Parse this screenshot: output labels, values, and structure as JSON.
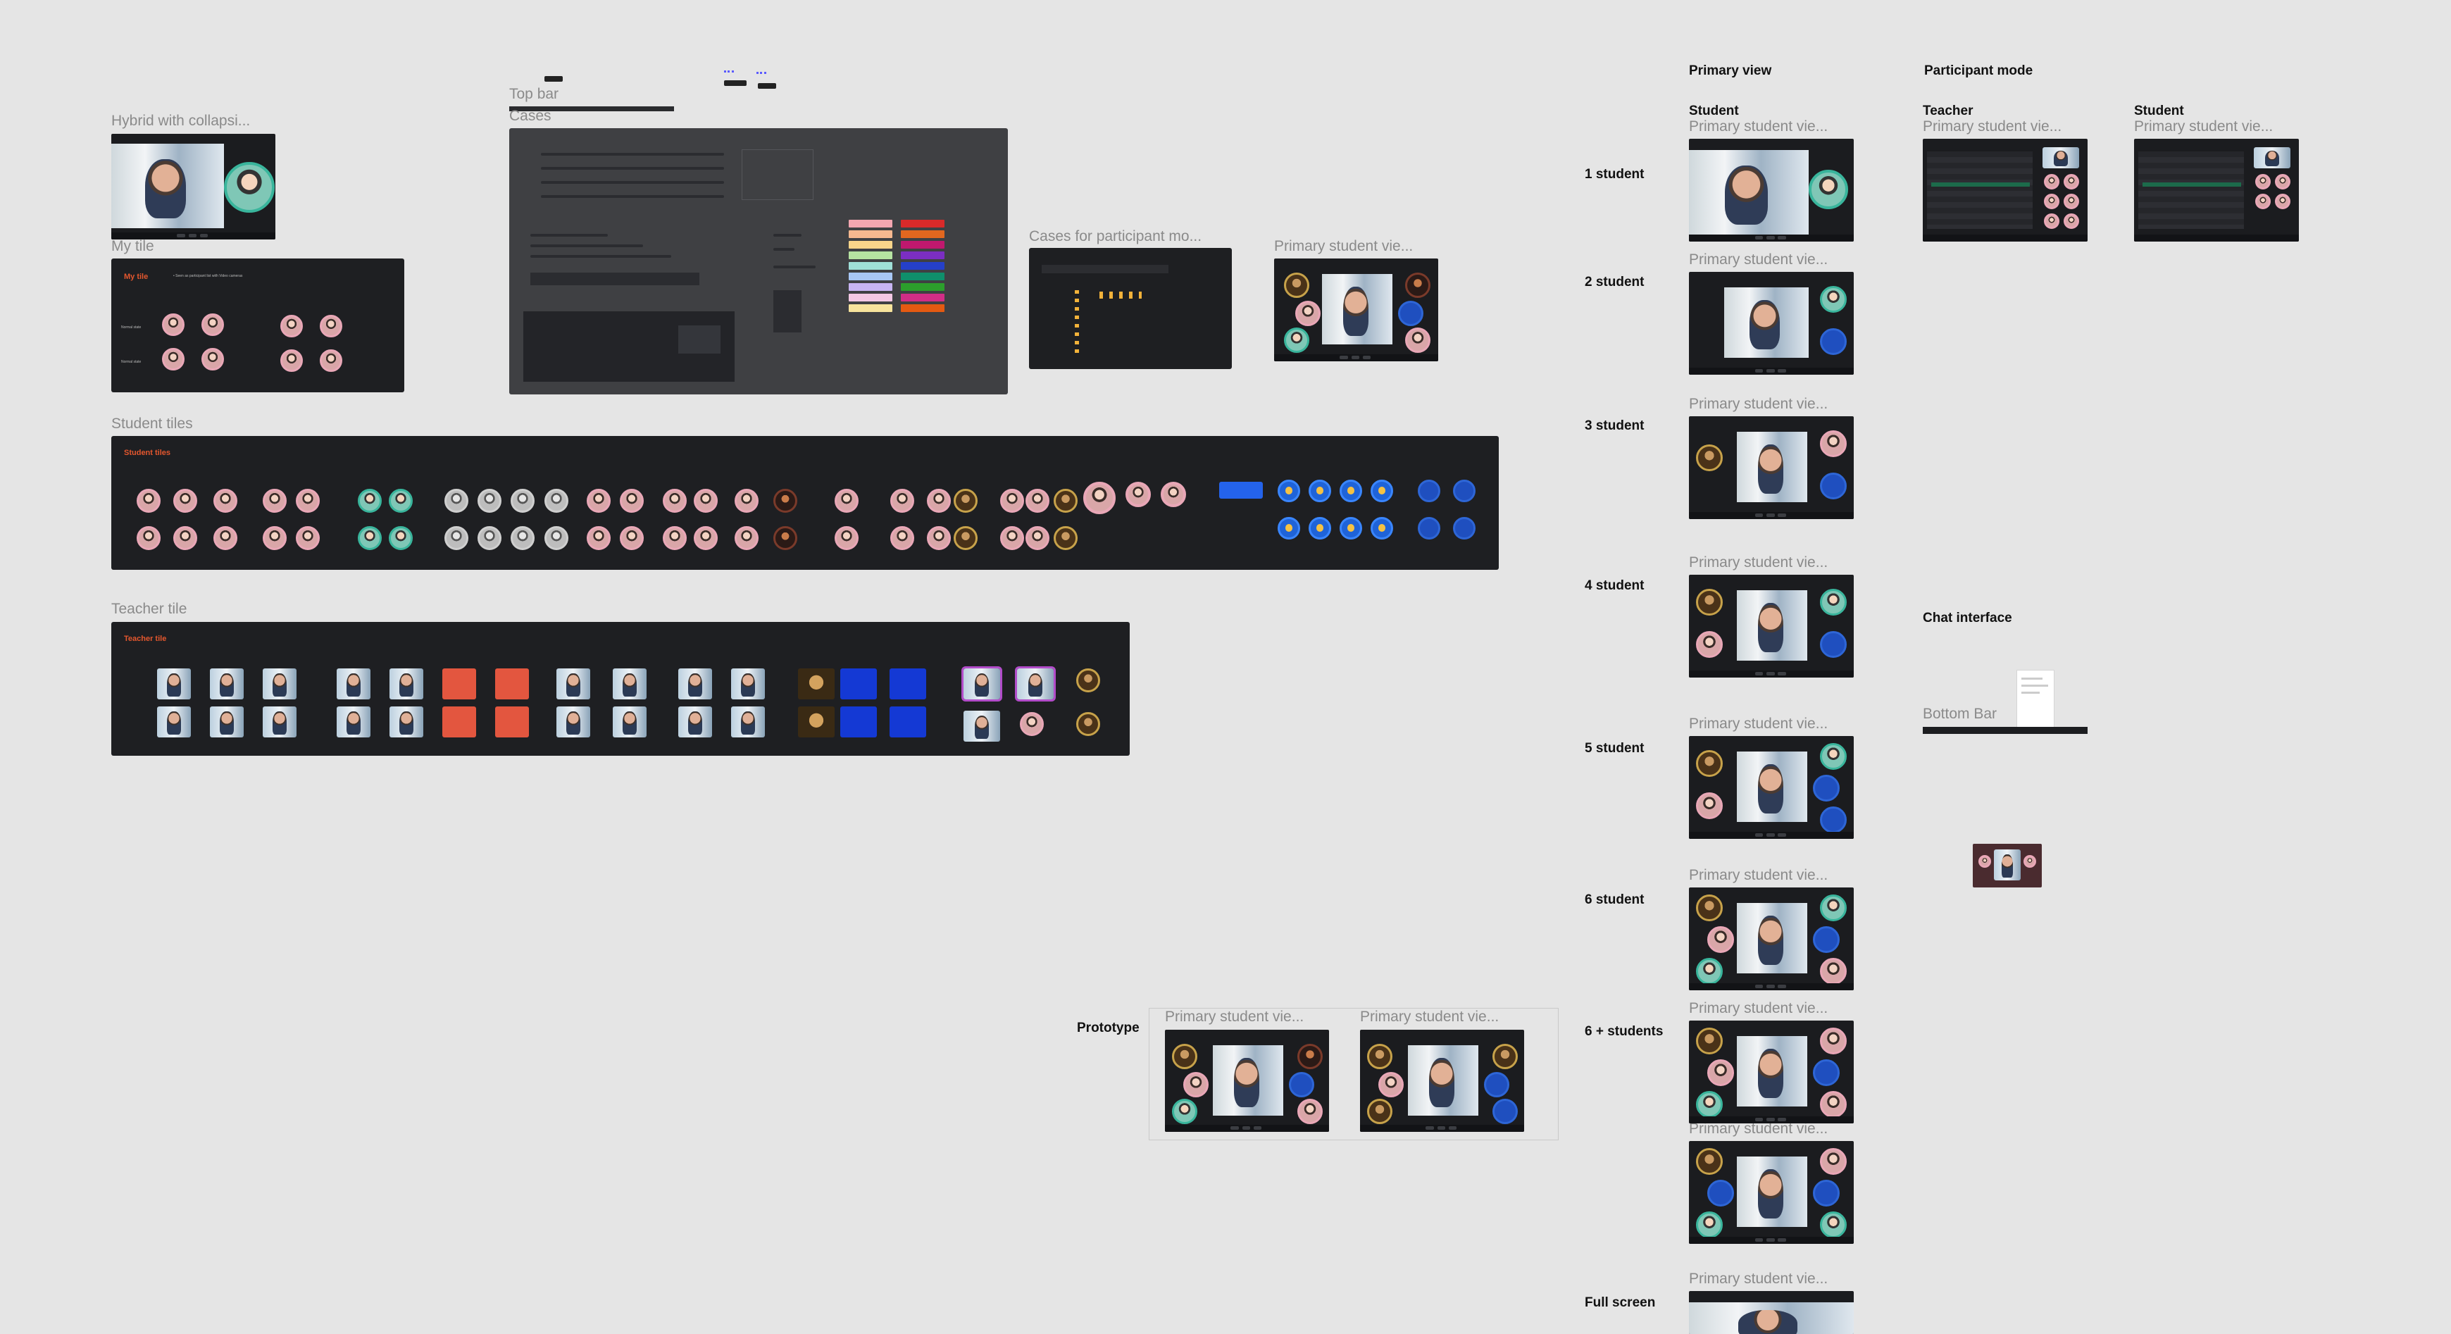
{
  "frames": {
    "hybrid": "Hybrid with collapsi...",
    "my_tile": "My tile",
    "top_bar": "Top bar",
    "cases": "Cases",
    "student_tiles": "Student tiles",
    "teacher_tile": "Teacher tile",
    "cases_participant": "Cases for participant mo...",
    "primary_student_view": "Primary student vie...",
    "bottom_bar": "Bottom Bar"
  },
  "panel_titles": {
    "my_tile": "My tile",
    "student_tiles": "Student tiles",
    "teacher_tile": "Teacher tile"
  },
  "my_tile_panel": {
    "note": "• Seen as participant list with Video cameras",
    "row_labels": [
      "Normal state",
      "Normal state"
    ]
  },
  "headings": {
    "primary_view": "Primary view",
    "participant_mode": "Participant mode",
    "student_col1": "Student",
    "teacher": "Teacher",
    "student_col3": "Student",
    "chat_interface": "Chat interface",
    "prototype": "Prototype"
  },
  "row_labels": {
    "r1": "1 student",
    "r2": "2 student",
    "r3": "3 student",
    "r4": "4 student",
    "r5": "5 student",
    "r6": "6 student",
    "r7": "6 + students",
    "r8": "Full screen"
  },
  "colors": {
    "canvas": "#e5e5e5",
    "panel_dark": "#1e1f22",
    "panel_grey": "#3f4043",
    "accent_orange": "#e4572e",
    "pink_ring": "#e9a7b7",
    "teal_ring": "#39b59c",
    "blue_tile": "#1439d4",
    "red_tile": "#e3563f"
  },
  "icons": [
    "avatar-icon",
    "thumbs-up-icon",
    "video-thumbnail",
    "color-swatch"
  ]
}
